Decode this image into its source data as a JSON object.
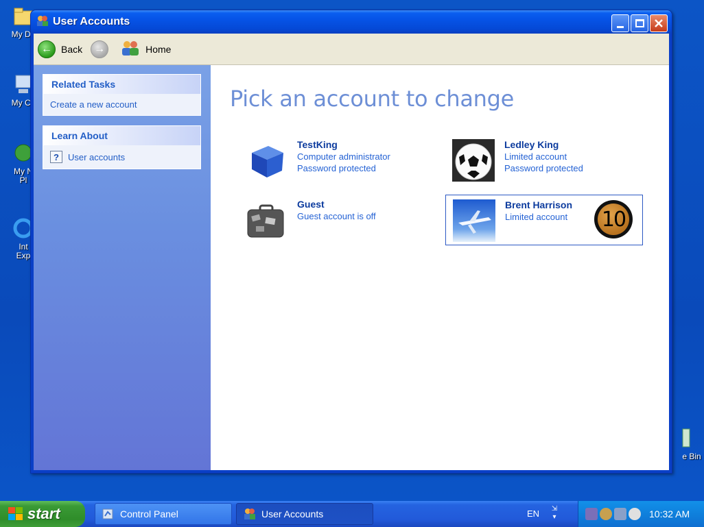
{
  "desktop": {
    "icons": [
      {
        "label": "My Do"
      },
      {
        "label": "My Co"
      },
      {
        "label": "My N",
        "label2": "Pl"
      },
      {
        "label": "Int",
        "label2": "Exp"
      },
      {
        "label": "e Bin"
      }
    ]
  },
  "window": {
    "title": "User Accounts",
    "toolbar": {
      "back_label": "Back",
      "home_label": "Home"
    },
    "sidebar": {
      "related_tasks": {
        "heading": "Related Tasks",
        "items": [
          {
            "label": "Create a new account"
          }
        ]
      },
      "learn_about": {
        "heading": "Learn About",
        "items": [
          {
            "label": "User accounts",
            "icon": "help-icon"
          }
        ]
      }
    },
    "main": {
      "heading": "Pick an account to change",
      "accounts": [
        {
          "name": "TestKing",
          "line1": "Computer administrator",
          "line2": "Password protected",
          "picture": "blue-cube-icon"
        },
        {
          "name": "Ledley King",
          "line1": "Limited account",
          "line2": "Password protected",
          "picture": "soccer-ball-icon"
        },
        {
          "name": "Guest",
          "line1": "Guest account is off",
          "line2": "",
          "picture": "suitcase-icon"
        },
        {
          "name": "Brent Harrison",
          "line1": "Limited account",
          "line2": "",
          "picture": "airplane-icon",
          "badge": "10",
          "selected": true
        }
      ]
    }
  },
  "taskbar": {
    "start_label": "start",
    "tasks": [
      {
        "label": "Control Panel",
        "active": false
      },
      {
        "label": "User Accounts",
        "active": true
      }
    ],
    "language": "EN",
    "clock": "10:32 AM"
  },
  "colors": {
    "heading": "#6d8fd6",
    "link": "#215dc6",
    "title_bar": "#0653e6"
  }
}
